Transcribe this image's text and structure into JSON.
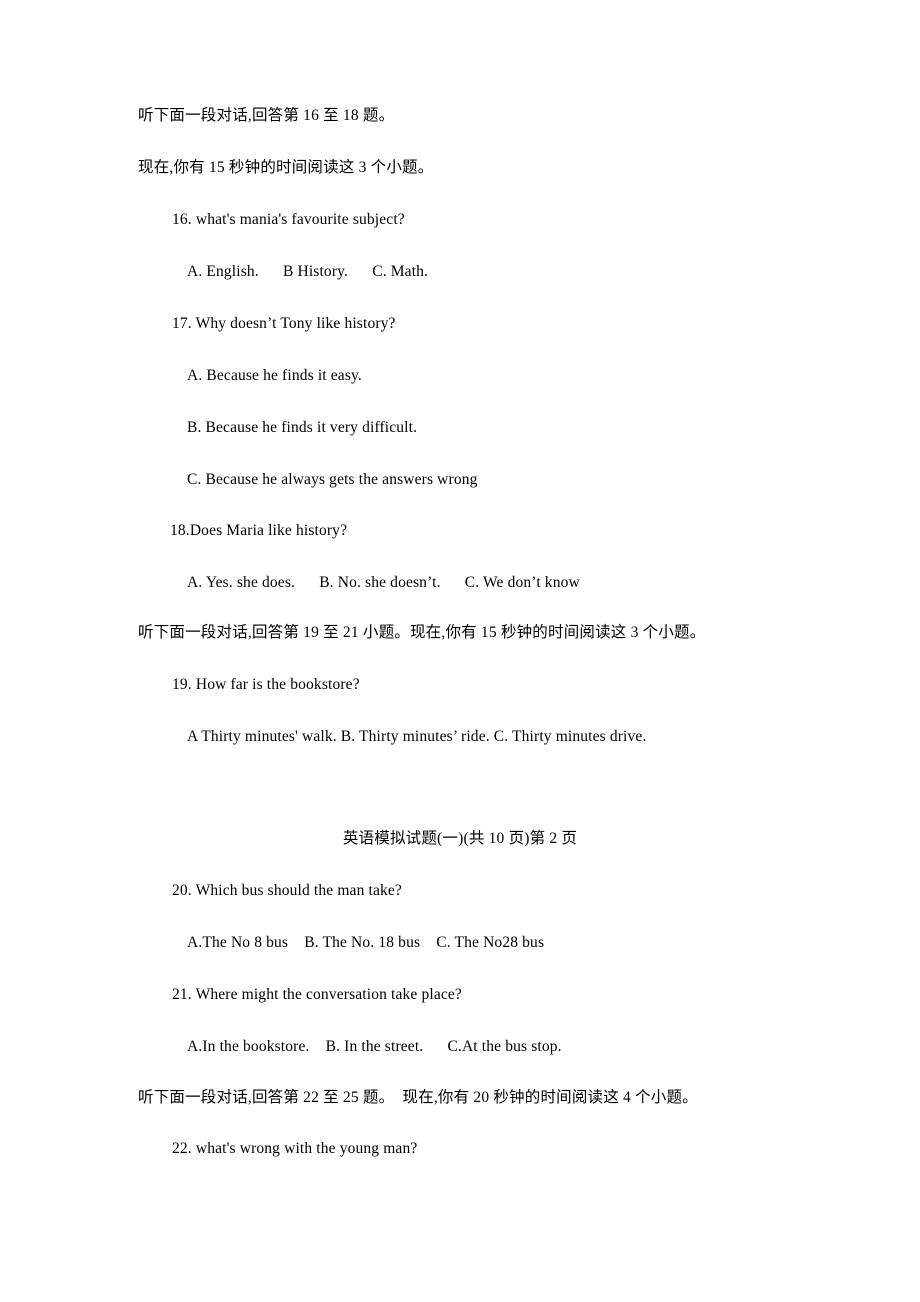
{
  "document": {
    "page_marker": "英语模拟试题(一)(共 10 页)第 2 页"
  },
  "sections": [
    {
      "instructions": [
        "听下面一段对话,回答第 16 至 18 题。",
        "现在,你有 15 秒钟的时间阅读这 3 个小题。"
      ],
      "questions": [
        {
          "stem": "16. what's mania's favourite subject?",
          "options_lines": [
            "A. English.      B History.      C. Math."
          ]
        },
        {
          "stem": "17. Why doesn’t Tony like history?",
          "options_lines": [
            "A. Because he finds it easy.",
            "B. Because he finds it very difficult.",
            "C. Because he always gets the answers wrong"
          ]
        },
        {
          "stem": "18.Does Maria like history?",
          "options_lines": [
            "A. Yes. she does.      B. No. she doesn’t.      C. We don’t know"
          ]
        }
      ]
    },
    {
      "instructions": [
        "听下面一段对话,回答第 19 至 21 小题。现在,你有 15 秒钟的时间阅读这 3 个小题。"
      ],
      "questions": [
        {
          "stem": "19. How far is the bookstore?",
          "options_lines": [
            "A Thirty minutes' walk. B. Thirty minutes’ ride. C. Thirty minutes drive."
          ]
        },
        {
          "stem": "20. Which bus should the man take?",
          "options_lines": [
            "A.The No 8 bus    B. The No. 18 bus    C. The No28 bus"
          ]
        },
        {
          "stem": "21. Where might the conversation take place?",
          "options_lines": [
            "A.In the bookstore.    B. In the street.      C.At the bus stop."
          ]
        }
      ]
    },
    {
      "instructions": [
        "听下面一段对话,回答第 22 至 25 题。  现在,你有 20 秒钟的时间阅读这 4 个小题。"
      ],
      "questions": [
        {
          "stem": "22. what's wrong with the young man?",
          "options_lines": []
        }
      ]
    }
  ]
}
